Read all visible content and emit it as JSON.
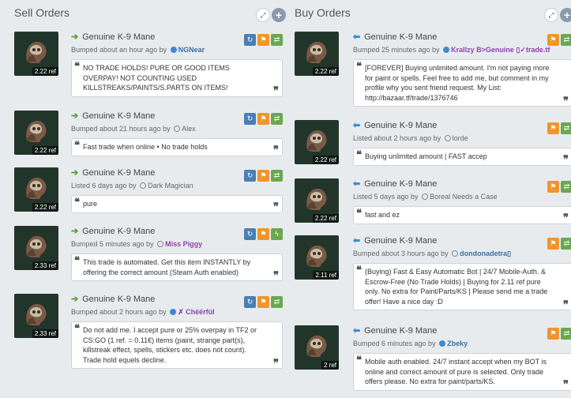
{
  "sell": {
    "title": "Sell Orders",
    "listings": [
      {
        "item": "Genuine K-9 Mane",
        "price": "2.22 ref",
        "status_text": "Bumped about an hour ago by",
        "user": "NGNear",
        "online": true,
        "user_color": "#3b6fa0",
        "note": "NO TRADE HOLDS! PURE OR GOOD ITEMS OVERPAY! NOT COUNTING USED KILLSTREAKS/PAINTS/S.PARTS ON ITEMS!"
      },
      {
        "item": "Genuine K-9 Mane",
        "price": "2.22 ref",
        "status_text": "Bumped about 21 hours ago by",
        "user": "Alex",
        "online": false,
        "user_color": "#666666",
        "note": "Fast trade when online • No trade holds"
      },
      {
        "item": "Genuine K-9 Mane",
        "price": "2.22 ref",
        "status_text": "Listed 6 days ago by",
        "user": "Dark Magician",
        "online": false,
        "user_color": "#666666",
        "note": "pure"
      },
      {
        "item": "Genuine K-9 Mane",
        "price": "2.33 ref",
        "status_text": "Bumped 5 minutes ago by",
        "user": "Miss Piggy",
        "online": false,
        "user_color": "#8e44ad",
        "note": "This trade is automated. Get this item INSTANTLY by offering the correct amount (Steam Auth enabled)"
      },
      {
        "item": "Genuine K-9 Mane",
        "price": "2.33 ref",
        "status_text": "Bumped about 2 hours ago by",
        "user": "✗ Chëërfül",
        "online": true,
        "user_color": "#8e44ad",
        "note": "Do not add me. I accept pure or 25% overpay in TF2 or CS:GO (1 ref. = 0.11€) items (paint, strange part(s), killstreak effect, spells, stickers etc. does not count). Trade hold equels decline."
      }
    ]
  },
  "buy": {
    "title": "Buy Orders",
    "listings": [
      {
        "item": "Genuine K-9 Mane",
        "price": "2.22 ref",
        "status_text": "Bumped 25 minutes ago by",
        "user": "Krallzy B>Genuine ▯✓trade.tf",
        "online": true,
        "user_color": "#8e44ad",
        "note": "[FOREVER] Buying unlimited amount. I'm not paying more for paint or spells. Feel free to add me, but comment in my profile why you sent friend request. My List: http://bazaar.tf/trade/1376746"
      },
      {
        "item": "Genuine K-9 Mane",
        "price": "2.22 ref",
        "status_text": "Listed about 2 hours ago by",
        "user": "lorde",
        "online": false,
        "user_color": "#666666",
        "note": "Buying unlimited amount | FAST accep"
      },
      {
        "item": "Genuine K-9 Mane",
        "price": "2.22 ref",
        "status_text": "Listed 5 days ago by",
        "user": "Boreal Needs a Case",
        "online": false,
        "user_color": "#666666",
        "note": "fast and ez"
      },
      {
        "item": "Genuine K-9 Mane",
        "price": "2.11 ref",
        "status_text": "Bumped about 3 hours ago by",
        "user": "dondonadetra▯",
        "online": false,
        "user_color": "#3b6fa0",
        "note": "(Buying) Fast & Easy Automatic Bot | 24/7 Mobile-Auth. & Escrow-Free (No Trade Holds) | Buying for 2.11 ref pure only. No extra for Paint/Parts/KS | Please send me a trade offer! Have a nice day :D"
      },
      {
        "item": "Genuine K-9 Mane",
        "price": "2 ref",
        "status_text": "Bumped 6 minutes ago by",
        "user": "Zbeky",
        "online": true,
        "user_color": "#3b6fa0",
        "note": "Mobile auth enabled. 24/7 instant accept when my BOT is online and correct amount of pure is selected. Only trade offers please. No extra for paint/parts/KS."
      }
    ]
  },
  "icons": {
    "expand": "expand-icon",
    "add": "plus-icon",
    "bump": "refresh-icon",
    "report": "flag-icon",
    "trade": "swap-icon",
    "instant": "lightning-icon"
  }
}
